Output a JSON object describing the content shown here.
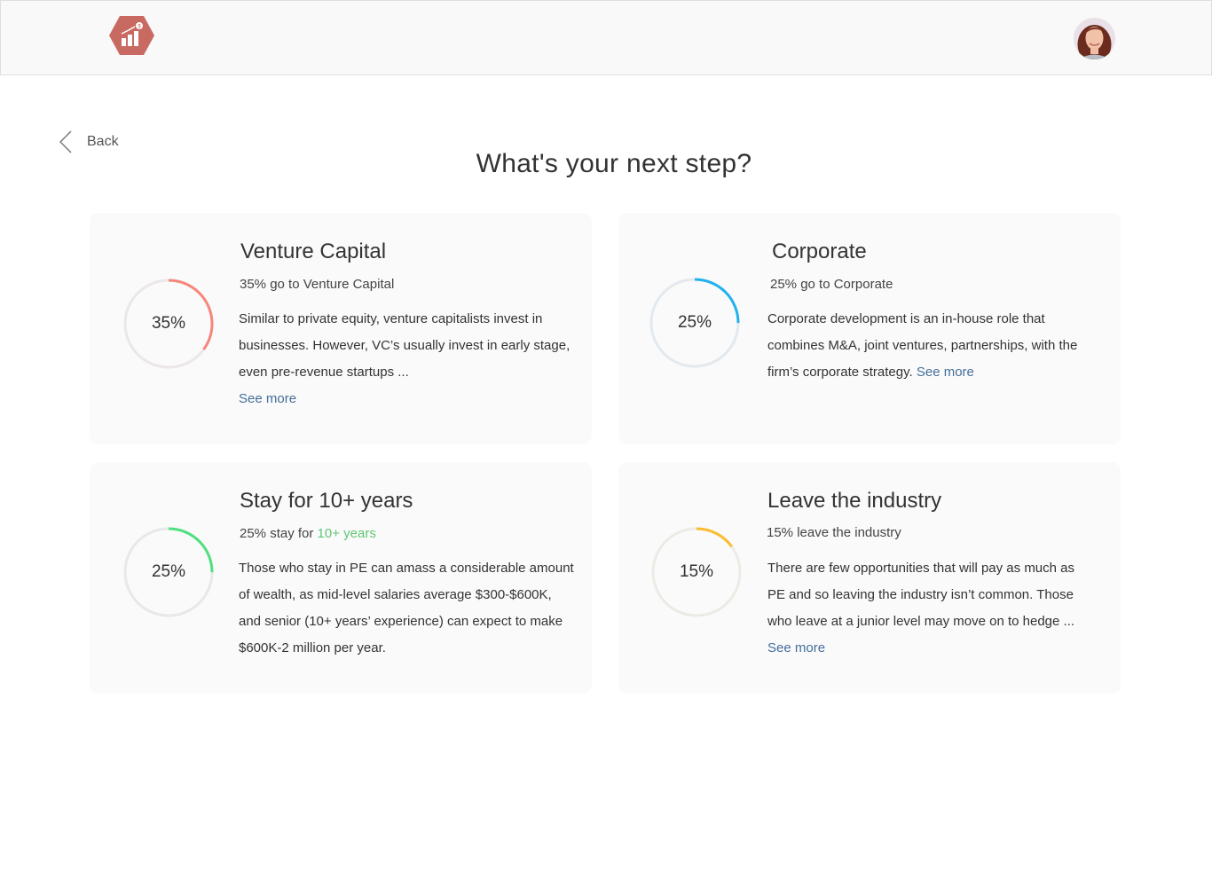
{
  "header": {
    "logo_icon": "chart-hexagon-icon",
    "logo_color": "#c96a62",
    "avatar_icon": "user-avatar"
  },
  "back": {
    "label": "Back",
    "icon": "chevron-left-icon"
  },
  "title": "What's your next step?",
  "cards": [
    {
      "title": "Venture Capital",
      "percent_label": "35%",
      "progress": 0.35,
      "ring_color": "#f7877b",
      "track_color": "#ece7e7",
      "subtitle": "35% go to Venture Capital",
      "description": "Similar to private equity, venture capitalists invest in businesses. However, VC’s usually invest in early stage, even pre-revenue startups ...",
      "link": "See more"
    },
    {
      "title": "Corporate",
      "percent_label": "25%",
      "progress": 0.25,
      "ring_color": "#23b2ee",
      "track_color": "#e3e9ee",
      "subtitle": "25% go to Corporate",
      "description": "Corporate development is an in-house role that combines M&A, joint ventures, partnerships, with the firm’s corporate strategy.",
      "link": "See more"
    },
    {
      "title": "Stay for 10+ years",
      "percent_label": "25%",
      "progress": 0.25,
      "ring_color": "#4fe080",
      "track_color": "#e6e9e7",
      "subtitle_prefix": "25% stay for",
      "subtitle_highlight": "10+ years",
      "highlight_color": "#5fc774",
      "description": "Those who stay in PE can amass a considerable amount of wealth, as mid-level salaries average $300-$600K, and senior (10+ years’ experience) can expect to make $600K-2 million per year."
    },
    {
      "title": "Leave the industry",
      "percent_label": "15%",
      "progress": 0.15,
      "ring_color": "#fbbc2e",
      "track_color": "#ebebe6",
      "subtitle": "15% leave the industry",
      "description": "There are few opportunities that will pay as much as PE and so leaving the industry isn’t common. Those who leave at a junior level may move on to hedge ...",
      "link": "See more"
    }
  ]
}
